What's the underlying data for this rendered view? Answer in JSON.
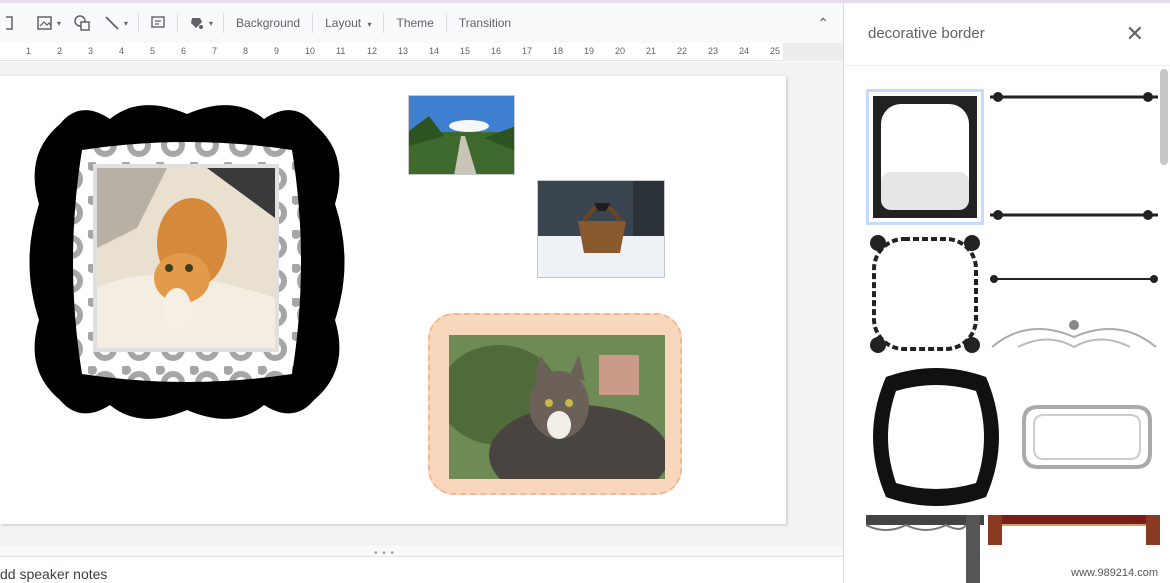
{
  "toolbar": {
    "background_label": "Background",
    "layout_label": "Layout",
    "theme_label": "Theme",
    "transition_label": "Transition"
  },
  "ruler": {
    "numbers": [
      "1",
      "2",
      "3",
      "4",
      "5",
      "6",
      "7",
      "8",
      "9",
      "10",
      "11",
      "12",
      "13",
      "14",
      "15",
      "16",
      "17",
      "18",
      "19",
      "20",
      "21",
      "22",
      "23",
      "24",
      "25"
    ]
  },
  "notes": {
    "placeholder": "dd speaker notes"
  },
  "panel": {
    "search_text": "decorative border",
    "close_glyph": "✕"
  },
  "icons": {
    "dropdown": "▾",
    "collapse": "⌃"
  },
  "watermark": "www.989214.com",
  "colors": {
    "selected_result": "#c6dafc",
    "peach_frame": "#f8d7bd",
    "accent": "#1a73e8"
  }
}
